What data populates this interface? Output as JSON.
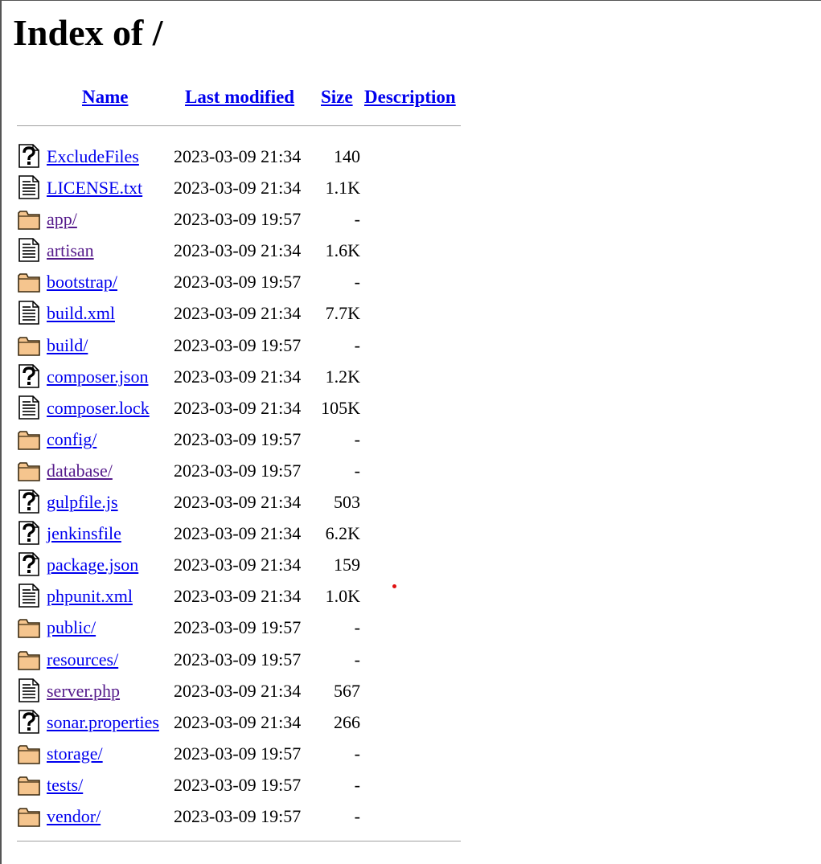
{
  "title": "Index of /",
  "columns": {
    "name": "Name",
    "last_modified": "Last modified",
    "size": "Size",
    "description": "Description"
  },
  "entries": [
    {
      "name": "ExcludeFiles",
      "modified": "2023-03-09 21:34",
      "size": "140",
      "icon": "unknown-file-icon",
      "visited": false
    },
    {
      "name": "LICENSE.txt",
      "modified": "2023-03-09 21:34",
      "size": "1.1K",
      "icon": "text-file-icon",
      "visited": false
    },
    {
      "name": "app/",
      "modified": "2023-03-09 19:57",
      "size": "-",
      "icon": "folder-icon",
      "visited": true
    },
    {
      "name": "artisan",
      "modified": "2023-03-09 21:34",
      "size": "1.6K",
      "icon": "text-file-icon",
      "visited": true
    },
    {
      "name": "bootstrap/",
      "modified": "2023-03-09 19:57",
      "size": "-",
      "icon": "folder-icon",
      "visited": false
    },
    {
      "name": "build.xml",
      "modified": "2023-03-09 21:34",
      "size": "7.7K",
      "icon": "text-file-icon",
      "visited": false
    },
    {
      "name": "build/",
      "modified": "2023-03-09 19:57",
      "size": "-",
      "icon": "folder-icon",
      "visited": false
    },
    {
      "name": "composer.json",
      "modified": "2023-03-09 21:34",
      "size": "1.2K",
      "icon": "unknown-file-icon",
      "visited": false
    },
    {
      "name": "composer.lock",
      "modified": "2023-03-09 21:34",
      "size": "105K",
      "icon": "text-file-icon",
      "visited": false
    },
    {
      "name": "config/",
      "modified": "2023-03-09 19:57",
      "size": "-",
      "icon": "folder-icon",
      "visited": false
    },
    {
      "name": "database/",
      "modified": "2023-03-09 19:57",
      "size": "-",
      "icon": "folder-icon",
      "visited": true
    },
    {
      "name": "gulpfile.js",
      "modified": "2023-03-09 21:34",
      "size": "503",
      "icon": "unknown-file-icon",
      "visited": false
    },
    {
      "name": "jenkinsfile",
      "modified": "2023-03-09 21:34",
      "size": "6.2K",
      "icon": "unknown-file-icon",
      "visited": false
    },
    {
      "name": "package.json",
      "modified": "2023-03-09 21:34",
      "size": "159",
      "icon": "unknown-file-icon",
      "visited": false
    },
    {
      "name": "phpunit.xml",
      "modified": "2023-03-09 21:34",
      "size": "1.0K",
      "icon": "text-file-icon",
      "visited": false
    },
    {
      "name": "public/",
      "modified": "2023-03-09 19:57",
      "size": "-",
      "icon": "folder-icon",
      "visited": false
    },
    {
      "name": "resources/",
      "modified": "2023-03-09 19:57",
      "size": "-",
      "icon": "folder-icon",
      "visited": false
    },
    {
      "name": "server.php",
      "modified": "2023-03-09 21:34",
      "size": "567",
      "icon": "text-file-icon",
      "visited": true
    },
    {
      "name": "sonar.properties",
      "modified": "2023-03-09 21:34",
      "size": "266",
      "icon": "unknown-file-icon",
      "visited": false
    },
    {
      "name": "storage/",
      "modified": "2023-03-09 19:57",
      "size": "-",
      "icon": "folder-icon",
      "visited": false
    },
    {
      "name": "tests/",
      "modified": "2023-03-09 19:57",
      "size": "-",
      "icon": "folder-icon",
      "visited": false
    },
    {
      "name": "vendor/",
      "modified": "2023-03-09 19:57",
      "size": "-",
      "icon": "folder-icon",
      "visited": false
    }
  ],
  "colors": {
    "link": "#0000ee",
    "visited_link": "#551a8b",
    "folder_fill": "#f5c58e",
    "rule": "#a0a0a0"
  }
}
